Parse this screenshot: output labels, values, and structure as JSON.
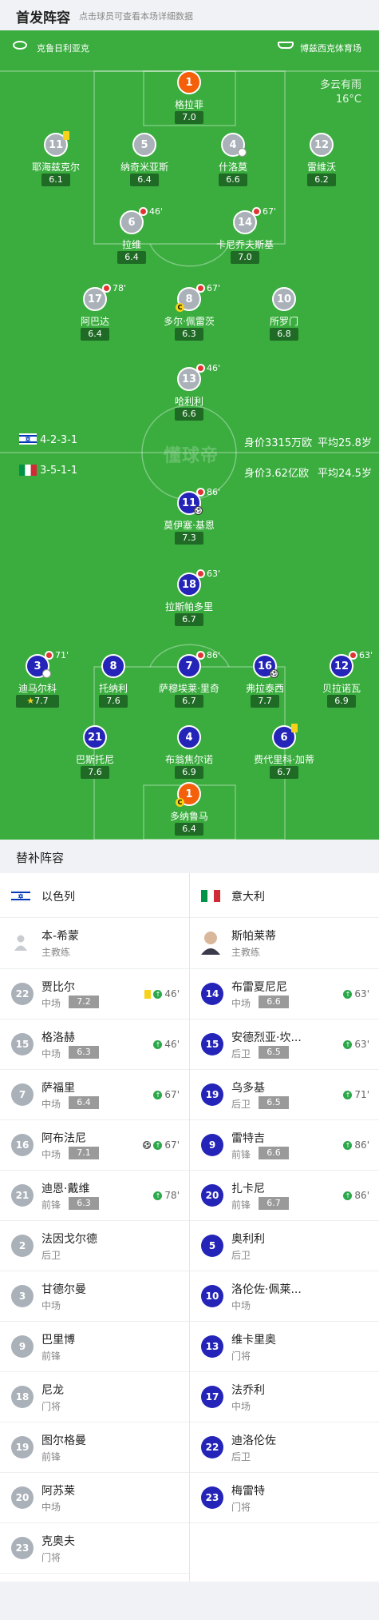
{
  "header": {
    "title": "首发阵容",
    "subtitle": "点击球员可查看本场详细数据"
  },
  "match": {
    "home_team": "克鲁日利亚克",
    "venue": "博兹西克体育场",
    "weather": "多云有雨",
    "temperature": "16°C",
    "watermark": "懂球帝"
  },
  "home_info": {
    "formation": "4-2-3-1",
    "value": "身价3315万欧",
    "age": "平均25.8岁",
    "flag_colors": [
      "#ffffff",
      "#0038b8"
    ]
  },
  "away_info": {
    "formation": "3-5-1-1",
    "value": "身价3.62亿欧",
    "age": "平均24.5岁",
    "flag_colors": [
      "#009246",
      "#ffffff",
      "#ce2b37"
    ]
  },
  "home_players": [
    {
      "num": "1",
      "name": "格拉菲",
      "rating": "7.0",
      "gk": true
    },
    {
      "num": "11",
      "name": "耶海兹克尔",
      "rating": "6.1",
      "yellow": true
    },
    {
      "num": "5",
      "name": "纳奇米亚斯",
      "rating": "6.4"
    },
    {
      "num": "4",
      "name": "什洛莫",
      "rating": "6.6",
      "boot": true
    },
    {
      "num": "12",
      "name": "雷维沃",
      "rating": "6.2"
    },
    {
      "num": "6",
      "name": "拉维",
      "rating": "6.4",
      "sub": "46'"
    },
    {
      "num": "14",
      "name": "卡尼乔夫斯基",
      "rating": "7.0",
      "sub": "67'"
    },
    {
      "num": "17",
      "name": "阿巴达",
      "rating": "6.4",
      "sub": "78'"
    },
    {
      "num": "8",
      "name": "多尔·佩雷茨",
      "rating": "6.3",
      "sub": "67'",
      "captain": true
    },
    {
      "num": "10",
      "name": "所罗门",
      "rating": "6.8"
    },
    {
      "num": "13",
      "name": "哈利利",
      "rating": "6.6",
      "sub": "46'"
    }
  ],
  "away_players": [
    {
      "num": "11",
      "name": "莫伊塞·基恩",
      "rating": "7.3",
      "sub": "86'",
      "ball": true
    },
    {
      "num": "18",
      "name": "拉斯帕多里",
      "rating": "6.7",
      "sub": "63'"
    },
    {
      "num": "3",
      "name": "迪马尔科",
      "rating": "7.7",
      "sub": "71'",
      "boot": true,
      "star": true
    },
    {
      "num": "8",
      "name": "托纳利",
      "rating": "7.6"
    },
    {
      "num": "7",
      "name": "萨穆埃莱·里奇",
      "rating": "6.7",
      "sub": "86'"
    },
    {
      "num": "16",
      "name": "弗拉泰西",
      "rating": "7.7",
      "ball": true
    },
    {
      "num": "12",
      "name": "贝拉诺瓦",
      "rating": "6.9",
      "sub": "63'"
    },
    {
      "num": "21",
      "name": "巴斯托尼",
      "rating": "7.6"
    },
    {
      "num": "4",
      "name": "布翁焦尔诺",
      "rating": "6.9"
    },
    {
      "num": "6",
      "name": "费代里科·加蒂",
      "rating": "6.7",
      "yellow": true
    },
    {
      "num": "1",
      "name": "多纳鲁马",
      "rating": "6.4",
      "gk": true,
      "captain": true
    }
  ],
  "captain_label": "C",
  "star_icon": "★",
  "subs_header": "替补阵容",
  "bench_home": {
    "team": "以色列",
    "coach": {
      "name": "本-希蒙",
      "role": "主教练"
    },
    "players": [
      {
        "num": "22",
        "name": "贾比尔",
        "pos": "中场",
        "rating": "7.2",
        "yellow": true,
        "in": "46'"
      },
      {
        "num": "15",
        "name": "格洛赫",
        "pos": "中场",
        "rating": "6.3",
        "in": "46'"
      },
      {
        "num": "7",
        "name": "萨福里",
        "pos": "中场",
        "rating": "6.4",
        "in": "67'"
      },
      {
        "num": "16",
        "name": "阿布法尼",
        "pos": "中场",
        "rating": "7.1",
        "ball": true,
        "in": "67'"
      },
      {
        "num": "21",
        "name": "迪恩·戴维",
        "pos": "前锋",
        "rating": "6.3",
        "in": "78'"
      },
      {
        "num": "2",
        "name": "法因戈尔德",
        "pos": "后卫"
      },
      {
        "num": "3",
        "name": "甘德尔曼",
        "pos": "中场"
      },
      {
        "num": "9",
        "name": "巴里博",
        "pos": "前锋"
      },
      {
        "num": "18",
        "name": "尼龙",
        "pos": "门将"
      },
      {
        "num": "19",
        "name": "图尔格曼",
        "pos": "前锋"
      },
      {
        "num": "20",
        "name": "阿苏莱",
        "pos": "中场"
      },
      {
        "num": "23",
        "name": "克奥夫",
        "pos": "门将"
      }
    ]
  },
  "bench_away": {
    "team": "意大利",
    "coach": {
      "name": "斯帕莱蒂",
      "role": "主教练"
    },
    "players": [
      {
        "num": "14",
        "name": "布雷夏尼尼",
        "pos": "中场",
        "rating": "6.6",
        "in": "63'"
      },
      {
        "num": "15",
        "name": "安德烈亚·坎...",
        "pos": "后卫",
        "rating": "6.5",
        "in": "63'"
      },
      {
        "num": "19",
        "name": "乌多基",
        "pos": "后卫",
        "rating": "6.5",
        "in": "71'"
      },
      {
        "num": "9",
        "name": "雷特吉",
        "pos": "前锋",
        "rating": "6.6",
        "in": "86'"
      },
      {
        "num": "20",
        "name": "扎卡尼",
        "pos": "前锋",
        "rating": "6.7",
        "in": "86'"
      },
      {
        "num": "5",
        "name": "奥利利",
        "pos": "后卫"
      },
      {
        "num": "10",
        "name": "洛伦佐·佩莱...",
        "pos": "中场"
      },
      {
        "num": "13",
        "name": "维卡里奥",
        "pos": "门将"
      },
      {
        "num": "17",
        "name": "法乔利",
        "pos": "中场"
      },
      {
        "num": "22",
        "name": "迪洛伦佐",
        "pos": "后卫"
      },
      {
        "num": "23",
        "name": "梅雷特",
        "pos": "门将"
      }
    ]
  }
}
